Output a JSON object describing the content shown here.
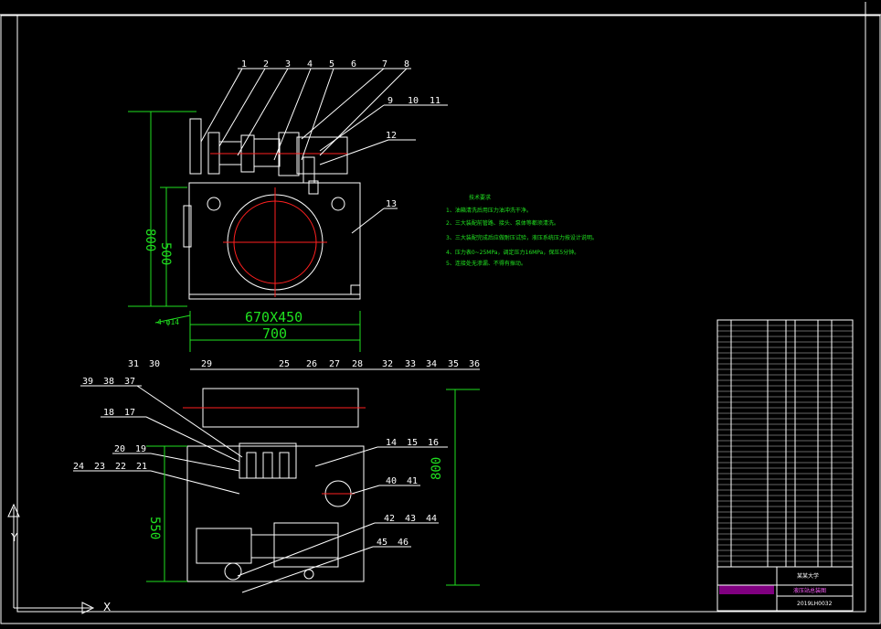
{
  "drawing": {
    "background": "#000000",
    "line_color": "#ffffff",
    "center_color": "#ff2020",
    "dim_color": "#20e020",
    "title_accent": "#ff00ff",
    "top_view_callouts": [
      "1",
      "2",
      "3",
      "4",
      "5",
      "6",
      "7",
      "8",
      "9",
      "10",
      "11",
      "12",
      "13"
    ],
    "top_view_dims": {
      "height_total": "800",
      "height_tank": "500",
      "tank_size": "670X450",
      "width": "700",
      "holes": "4-φ14"
    },
    "bottom_view_callouts": [
      "25",
      "26",
      "27",
      "28",
      "29",
      "30",
      "31",
      "32",
      "33",
      "34",
      "35",
      "36",
      "37",
      "38",
      "39",
      "17",
      "18",
      "19",
      "20",
      "21",
      "22",
      "23",
      "24",
      "14",
      "15",
      "16",
      "40",
      "41",
      "42",
      "43",
      "44",
      "45",
      "46"
    ],
    "bottom_view_dims": {
      "height_total": "800",
      "height_tank": "550"
    },
    "notes": {
      "title": "技术要求",
      "lines": [
        "1、油箱清洗后用压力油冲洗干净。",
        "2、三大装配前管路、接头、泵体等都须清洗。",
        "3、三大装配完成后应做耐压试验，液压系统压力按设计说明。",
        "4、压力表0~25MPa，调定压力16MPa，保压5分钟。",
        "5、连接处无渗漏、不得有振动。"
      ]
    },
    "title_block": {
      "name": "液压站总装图",
      "school": "某某大学",
      "drawing_no": "2019LH0032"
    },
    "axes": {
      "x": "X",
      "y": "Y"
    }
  }
}
